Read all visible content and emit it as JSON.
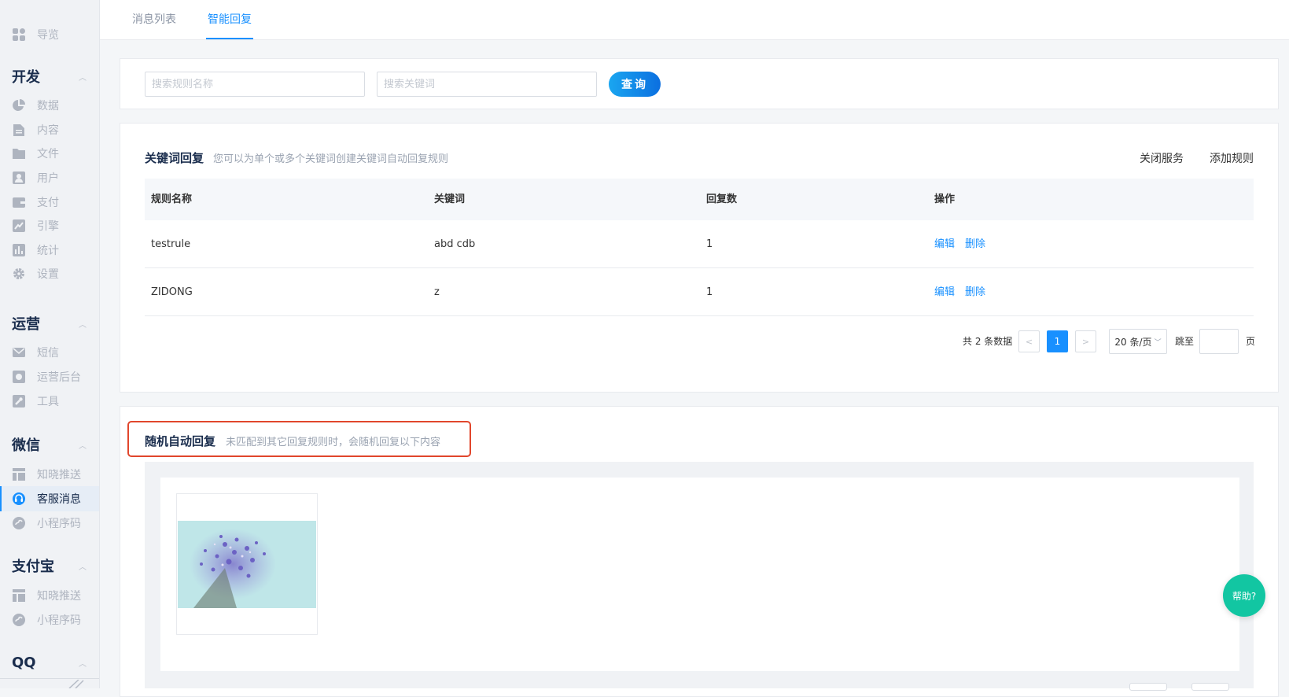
{
  "sidebar": {
    "top_item": {
      "label": "导览",
      "icon": "grid-icon"
    },
    "groups": [
      {
        "title": "开发",
        "items": [
          {
            "label": "数据",
            "icon": "pie-chart-icon"
          },
          {
            "label": "内容",
            "icon": "document-icon"
          },
          {
            "label": "文件",
            "icon": "folder-icon"
          },
          {
            "label": "用户",
            "icon": "user-icon"
          },
          {
            "label": "支付",
            "icon": "wallet-icon"
          },
          {
            "label": "引擎",
            "icon": "trend-icon"
          },
          {
            "label": "统计",
            "icon": "bar-chart-icon"
          },
          {
            "label": "设置",
            "icon": "gear-icon"
          }
        ]
      },
      {
        "title": "运营",
        "items": [
          {
            "label": "短信",
            "icon": "mail-icon"
          },
          {
            "label": "运营后台",
            "icon": "console-icon"
          },
          {
            "label": "工具",
            "icon": "wrench-icon"
          }
        ]
      },
      {
        "title": "微信",
        "items": [
          {
            "label": "知晓推送",
            "icon": "layout-icon"
          },
          {
            "label": "客服消息",
            "icon": "headset-icon",
            "active": true
          },
          {
            "label": "小程序码",
            "icon": "miniprogram-icon"
          }
        ]
      },
      {
        "title": "支付宝",
        "items": [
          {
            "label": "知晓推送",
            "icon": "layout-icon"
          },
          {
            "label": "小程序码",
            "icon": "miniprogram-icon"
          }
        ]
      },
      {
        "title": "QQ",
        "items": []
      }
    ],
    "colors": {
      "active_accent": "#1890ff",
      "icon": "#aeb4bf"
    }
  },
  "tabs": [
    {
      "label": "消息列表",
      "active": false
    },
    {
      "label": "智能回复",
      "active": true
    }
  ],
  "search": {
    "rule_placeholder": "搜索规则名称",
    "keyword_placeholder": "搜索关键词",
    "query_label": "查询"
  },
  "keyword_section": {
    "title": "关键词回复",
    "description": "您可以为单个或多个关键词创建关键词自动回复规则",
    "close_service": "关闭服务",
    "add_rule": "添加规则",
    "columns": [
      "规则名称",
      "关键词",
      "回复数",
      "操作"
    ],
    "rows": [
      {
        "name": "testrule",
        "keywords": "abd cdb",
        "count": "1",
        "edit": "编辑",
        "delete": "删除"
      },
      {
        "name": "ZIDONG",
        "keywords": "z",
        "count": "1",
        "edit": "编辑",
        "delete": "删除"
      }
    ]
  },
  "pagination": {
    "total_text": "共 2 条数据",
    "prev": "<",
    "current_page": "1",
    "next": ">",
    "page_size": "20 条/页",
    "jump_label": "跳至",
    "page_unit": "页"
  },
  "random_section": {
    "title": "随机自动回复",
    "description": "未匹配到其它回复规则时，会随机回复以下内容"
  },
  "help_label": "帮助?",
  "accent_color": "#1890ff",
  "highlight_color": "#e1462c"
}
